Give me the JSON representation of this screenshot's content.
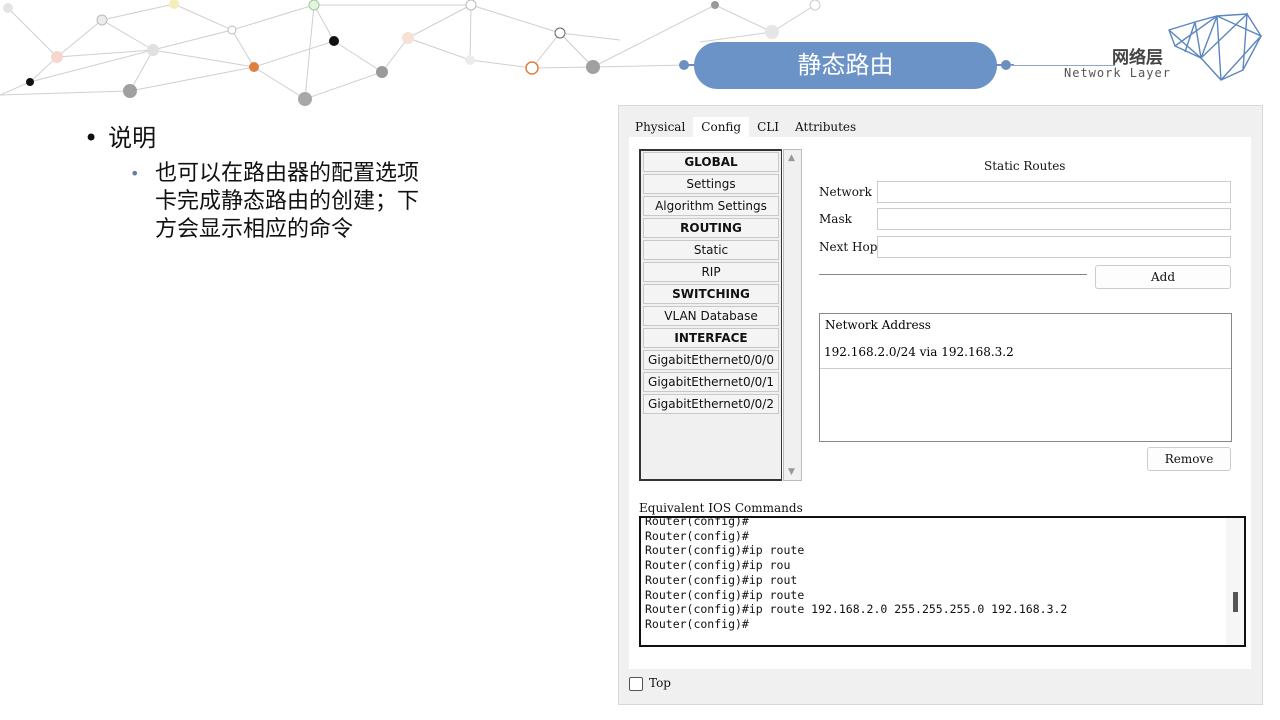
{
  "header": {
    "title": "静态路由",
    "brand_cn": "网络层",
    "brand_en": "Network Layer"
  },
  "content": {
    "bullet1": "说明",
    "bullet2_lines": [
      "也可以在路由器的配置选项",
      "卡完成静态路由的创建；下",
      "方会显示相应的命令"
    ]
  },
  "window": {
    "tabs": [
      "Physical",
      "Config",
      "CLI",
      "Attributes"
    ],
    "active_tab": "Config",
    "nav_items": [
      {
        "label": "GLOBAL",
        "head": true
      },
      {
        "label": "Settings",
        "head": false
      },
      {
        "label": "Algorithm Settings",
        "head": false
      },
      {
        "label": "ROUTING",
        "head": true
      },
      {
        "label": "Static",
        "head": false
      },
      {
        "label": "RIP",
        "head": false
      },
      {
        "label": "SWITCHING",
        "head": true
      },
      {
        "label": "VLAN Database",
        "head": false
      },
      {
        "label": "INTERFACE",
        "head": true
      },
      {
        "label": "GigabitEthernet0/0/0",
        "head": false
      },
      {
        "label": "GigabitEthernet0/0/1",
        "head": false
      },
      {
        "label": "GigabitEthernet0/0/2",
        "head": false
      }
    ],
    "static_routes": {
      "title": "Static Routes",
      "network_label": "Network",
      "network_value": "",
      "mask_label": "Mask",
      "mask_value": "",
      "nexthop_label": "Next Hop",
      "nexthop_value": "",
      "add_label": "Add",
      "list_header": "Network Address",
      "routes": [
        "192.168.2.0/24 via 192.168.3.2"
      ],
      "remove_label": "Remove"
    },
    "commands": {
      "label": "Equivalent IOS Commands",
      "lines": [
        "Router(config)#",
        "Router(config)#",
        "Router(config)#ip route",
        "Router(config)#ip rou",
        "Router(config)#ip rout",
        "Router(config)#ip route",
        "Router(config)#ip route 192.168.2.0 255.255.255.0 192.168.3.2",
        "Router(config)#"
      ]
    },
    "top_label": "Top"
  }
}
